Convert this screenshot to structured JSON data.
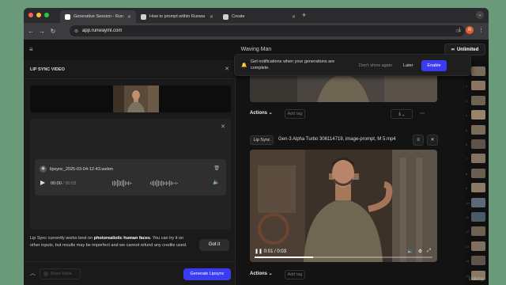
{
  "browser": {
    "tabs": [
      {
        "title": "Generative Session - Run"
      },
      {
        "title": "How to prompt within Runwa"
      },
      {
        "title": "Create"
      }
    ],
    "new_tab": "+",
    "url": "app.runwayml.com",
    "profile_initial": "R"
  },
  "app": {
    "title": "Waving Man",
    "plan_badge": "Unlimited"
  },
  "lip_sync_panel": {
    "title": "LIP SYNC VIDEO",
    "audio": {
      "file_name": "lipsync_2025-03-04-12-43.webm",
      "current_time": "00:00",
      "separator": "/",
      "total_time": "00:03"
    },
    "note_prefix": "Lip Sync currently works best on ",
    "note_bold": "photorealistic human faces",
    "note_suffix": ". You can try it on other inputs, but results may be imperfect and we cannot refund any credits used.",
    "got_it": "Got it",
    "voice_placeholder": "Rose Kelia",
    "generate_button": "Generate Lipsync"
  },
  "notification": {
    "text": "Get notifications when your generations are complete.",
    "dont_show": "Don't show again",
    "later": "Later",
    "enable": "Enable"
  },
  "feed": {
    "actions_label": "Actions",
    "add_tag": "Add tag",
    "generation_badge": "Lip Sync",
    "generation_title": "Gen-3 Alpha Turbo 306114719, image-prompt, M 5.mp4",
    "video_time": "0:01 / 0:03",
    "video_progress": 0.33
  },
  "thumbnails": {
    "numbers": [
      "1",
      "2",
      "3",
      "4",
      "5",
      "6",
      "7",
      "8",
      "9",
      "10",
      "11",
      "12",
      "13",
      "14",
      "15"
    ]
  },
  "watermark": "Udemy",
  "colors": {
    "accent": "#3b3cf2",
    "desktop": "#6a9a79"
  }
}
